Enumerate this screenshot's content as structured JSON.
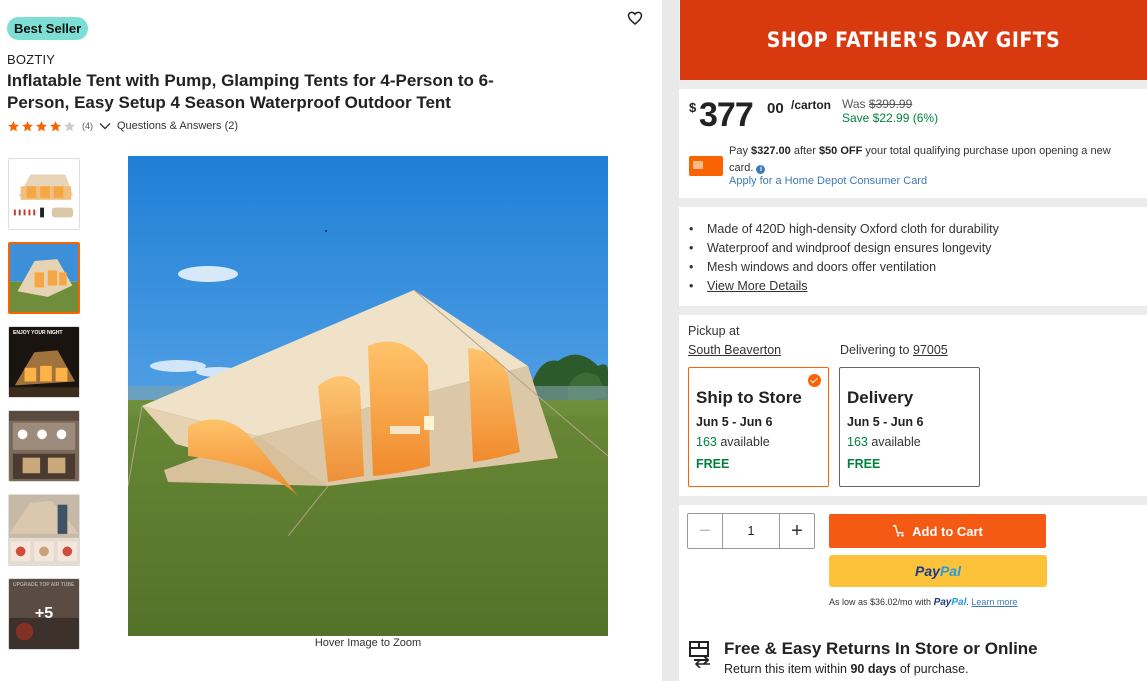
{
  "product": {
    "badge": "Best Seller",
    "brand": "BOZTIY",
    "title": "Inflatable Tent with Pump, Glamping Tents for 4-Person to 6-Person, Easy Setup 4 Season Waterproof Outdoor Tent",
    "rating": 4,
    "rating_max": 5,
    "review_count": "(4)",
    "qa_label": "Questions & Answers (2)",
    "thumbnails_more": "+5",
    "hover_zoom": "Hover Image to Zoom",
    "thumb_captions": [
      "ENJOY YOUR NIGHT",
      "UPGRADE TOP AIR TUBE"
    ]
  },
  "promo": {
    "label": "SHOP FATHER'S DAY GIFTS",
    "color": "#d8390f"
  },
  "price": {
    "dollar_sign": "$",
    "integer": "377",
    "cents": "00",
    "unit": "/carton",
    "was_label": "Was",
    "was_value": "$399.99",
    "save": "Save $22.99 (6%)"
  },
  "card_offer": {
    "pay_prefix": "Pay",
    "pay_amount": "$327.00",
    "after": "after",
    "discount": "$50 OFF",
    "rest": "your total qualifying purchase upon opening a new card.",
    "info_icon": "i",
    "apply_link": "Apply for a Home Depot Consumer Card"
  },
  "bullets": [
    "Made of 420D high-density Oxford cloth for durability",
    "Waterproof and windproof design ensures longevity",
    "Mesh windows and doors offer ventilation"
  ],
  "view_more": "View More Details",
  "fulfillment": {
    "pickup_label": "Pickup at",
    "store": "South Beaverton",
    "delivering_label": "Delivering to",
    "zip": "97005",
    "options": [
      {
        "title": "Ship to Store",
        "dates": "Jun 5 - Jun 6",
        "count": "163",
        "avail": "available",
        "cost": "FREE",
        "selected": true
      },
      {
        "title": "Delivery",
        "dates": "Jun 5 - Jun 6",
        "count": "163",
        "avail": "available",
        "cost": "FREE",
        "selected": false
      }
    ]
  },
  "cart": {
    "quantity": "1",
    "minus": "−",
    "plus": "+",
    "add_to_cart": "Add to Cart",
    "paypal_a": "Pay",
    "paypal_b": "Pal",
    "as_low_prefix": "As low as $36.02/mo with",
    "learn_more": "Learn more",
    "accent": "#f45a14"
  },
  "returns": {
    "title": "Free & Easy Returns In Store or Online",
    "sub_prefix": "Return this item within",
    "sub_days": "90 days",
    "sub_suffix": "of purchase."
  }
}
